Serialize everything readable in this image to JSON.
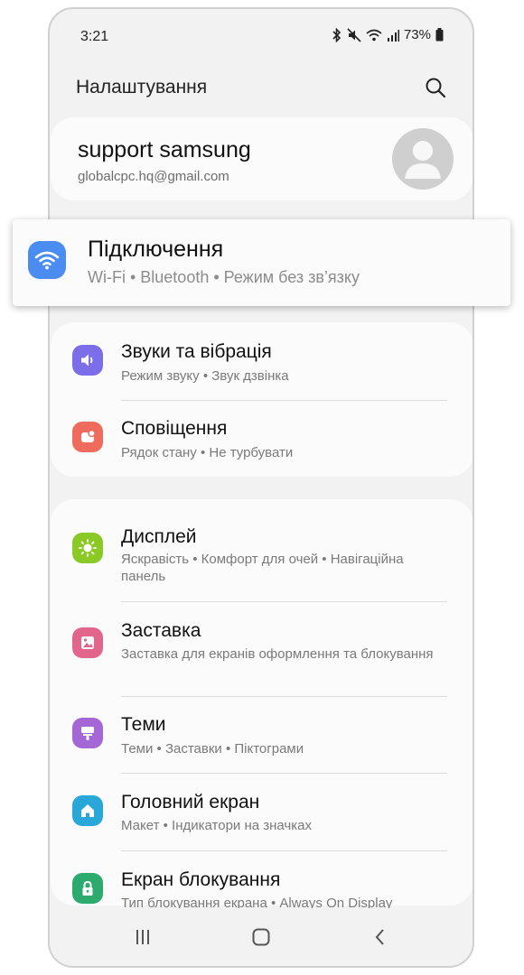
{
  "status_bar": {
    "time": "3:21",
    "battery": "73%"
  },
  "header": {
    "title": "Налаштування"
  },
  "account": {
    "name": "support samsung",
    "email": "globalcpc.hq@gmail.com"
  },
  "highlighted_item": {
    "title": "Підключення",
    "subtitle": "Wi-Fi  •  Bluetooth  •  Режим без зв’язку",
    "icon": "wifi-icon",
    "icon_color": "#4a8cf2"
  },
  "group1": [
    {
      "title": "Звуки та вібрація",
      "subtitle": "Режим звуку  •  Звук дзвінка",
      "icon": "volume-icon",
      "color": "#7b6ee8"
    },
    {
      "title": "Сповіщення",
      "subtitle": "Рядок стану  •  Не турбувати",
      "icon": "notification-icon",
      "color": "#ee6b5d"
    }
  ],
  "group2": [
    {
      "title": "Дисплей",
      "subtitle": "Яскравість  •  Комфорт для очей  •  Навігаційна панель",
      "icon": "brightness-icon",
      "color": "#8ac926"
    },
    {
      "title": "Заставка",
      "subtitle": "Заставка для екранів оформлення та блокування",
      "icon": "wallpaper-icon",
      "color": "#e2668c"
    },
    {
      "title": "Теми",
      "subtitle": "Теми  •  Заставки  •  Піктограми",
      "icon": "themes-icon",
      "color": "#a566d6"
    },
    {
      "title": "Головний екран",
      "subtitle": "Макет  •  Індикатори на значках",
      "icon": "home-icon",
      "color": "#2aa7d9"
    },
    {
      "title": "Екран блокування",
      "subtitle": "Тип блокування екрана  •  Always On Display",
      "icon": "lock-icon",
      "color": "#2daa6e"
    }
  ]
}
